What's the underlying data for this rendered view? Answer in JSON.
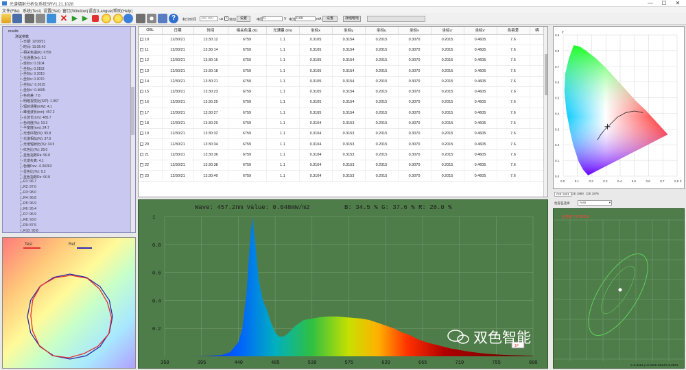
{
  "window": {
    "title": "光谱辐射分析仪系统SRV1.21.1028",
    "minimize": "—",
    "maximize": "☐",
    "close": "✕"
  },
  "menu": [
    "文件(File)",
    "系统(Test)",
    "设置(Set)",
    "窗口(Window)",
    "语言(Langue)",
    "帮助(Help)"
  ],
  "toolbar": {
    "icons": [
      "open-icon",
      "save-icon",
      "copy-icon",
      "paste-icon",
      "export-icon",
      "delete-icon",
      "run-icon",
      "run-all-icon",
      "stop-icon",
      "lamp-icon",
      "lamp2-icon",
      "refresh-icon",
      "calculator-icon",
      "settings-icon",
      "chart-icon",
      "help-icon"
    ],
    "integration_label": "积分时间",
    "integration_value": "300 000",
    "integration_unit": "us",
    "auto_label": "自动",
    "set_button": "设置",
    "voltage_label": "电压",
    "voltage_value": "0",
    "voltage_unit": "V",
    "current_label": "电流",
    "current_value": "0.00",
    "current_unit": "mA",
    "set_button2": "设置",
    "dark_button": "存储暗电"
  },
  "tree": {
    "root": "results",
    "node": "测试参数",
    "items": [
      "日期: 12/30/21",
      "时间: 13:35:40",
      "相关色温(K): 6759",
      "光通量(lm): 1.1",
      "坐标x: 0.3104",
      "坐标y: 0.3153",
      "坐标u: 0.2015",
      "坐标v: 0.3070",
      "坐标u': 0.2015",
      "坐标v': 0.4605",
      "色容差: 7.6",
      "明暗视觉比(S/P): 1.067",
      "辐射通量(mW): 4.1",
      "峰值波长(nm): 457.2",
      "主波长(nm): 485.7",
      "色纯度(%): 19.3",
      "半宽度(nm): 24.7",
      "光谱匹配(%): 95.8",
      "光谱相似(%): 37.6",
      "光谱辐射比(%): 34.5",
      "红色比(%): 28.0",
      "显色指数Ra: 96.8",
      "光谱失真: 4.1",
      "色偏Duv: -0.00263",
      "显色比(%): 9.2",
      "显色指数Re: 90.8",
      "R1: 96.7",
      "R2: 97.6",
      "R3: 98.0",
      "R4: 96.8",
      "R5: 96.9",
      "R6: 95.4",
      "R7: 96.9",
      "R8: 93.0",
      "R9: 87.5",
      "R10: 90.8"
    ]
  },
  "color_chart": {
    "legend_test": "Test",
    "legend_ref": "Ref",
    "test_color": "#e03030",
    "ref_color": "#2a2ab0"
  },
  "table": {
    "headers": [
      "OBL",
      "日期",
      "时间",
      "相关色温 (K)",
      "光通量 (lm)",
      "坐标x",
      "坐标y",
      "坐标u",
      "坐标v",
      "坐标u'",
      "坐标v'",
      "色容差",
      "明"
    ],
    "rows": [
      [
        "10",
        "12/30/21",
        "13:30:12",
        "6759",
        "1.1",
        "0.3105",
        "0.3154",
        "0.2015",
        "0.3070",
        "0.2015",
        "0.4605",
        "7.6"
      ],
      [
        "11",
        "12/30/21",
        "13:30:14",
        "6759",
        "1.1",
        "0.3105",
        "0.3154",
        "0.2015",
        "0.3070",
        "0.2015",
        "0.4605",
        "7.6"
      ],
      [
        "12",
        "12/30/21",
        "13:30:16",
        "6759",
        "1.1",
        "0.3105",
        "0.3154",
        "0.2015",
        "0.3070",
        "0.2015",
        "0.4605",
        "7.6"
      ],
      [
        "13",
        "12/30/21",
        "13:30:18",
        "6759",
        "1.1",
        "0.3105",
        "0.3154",
        "0.2015",
        "0.3070",
        "0.2015",
        "0.4605",
        "7.6"
      ],
      [
        "14",
        "12/30/21",
        "13:30:21",
        "6759",
        "1.1",
        "0.3105",
        "0.3154",
        "0.2015",
        "0.3070",
        "0.2015",
        "0.4605",
        "7.6"
      ],
      [
        "15",
        "12/30/21",
        "13:30:23",
        "6759",
        "1.1",
        "0.3105",
        "0.3154",
        "0.2015",
        "0.3070",
        "0.2015",
        "0.4605",
        "7.6"
      ],
      [
        "16",
        "12/30/21",
        "13:30:25",
        "6759",
        "1.1",
        "0.3105",
        "0.3154",
        "0.2015",
        "0.3070",
        "0.2015",
        "0.4605",
        "7.6"
      ],
      [
        "17",
        "12/30/21",
        "13:30:27",
        "6759",
        "1.1",
        "0.3105",
        "0.3154",
        "0.2015",
        "0.3070",
        "0.2015",
        "0.4605",
        "7.6"
      ],
      [
        "18",
        "12/30/21",
        "13:30:29",
        "6759",
        "1.1",
        "0.3104",
        "0.3153",
        "0.2015",
        "0.3070",
        "0.2015",
        "0.4605",
        "7.6"
      ],
      [
        "19",
        "12/30/21",
        "13:30:32",
        "6759",
        "1.1",
        "0.3104",
        "0.3153",
        "0.2015",
        "0.3070",
        "0.2015",
        "0.4605",
        "7.6"
      ],
      [
        "20",
        "12/30/21",
        "13:30:34",
        "6759",
        "1.1",
        "0.3104",
        "0.3153",
        "0.2015",
        "0.3070",
        "0.2015",
        "0.4605",
        "7.6"
      ],
      [
        "21",
        "12/30/21",
        "13:30:36",
        "6759",
        "1.1",
        "0.3104",
        "0.3153",
        "0.2015",
        "0.3070",
        "0.2015",
        "0.4605",
        "7.6"
      ],
      [
        "22",
        "12/30/21",
        "13:30:38",
        "6759",
        "1.1",
        "0.3104",
        "0.3153",
        "0.2015",
        "0.3070",
        "0.2015",
        "0.4605",
        "7.6"
      ],
      [
        "23",
        "12/30/21",
        "13:30:40",
        "6759",
        "1.1",
        "0.3104",
        "0.3153",
        "0.2015",
        "0.3070",
        "0.2015",
        "0.4605",
        "7.6"
      ]
    ]
  },
  "spectrum": {
    "header": "Wave: 457.2nm Value: 0.048mW/m2",
    "ratios": "B: 34.5 %  G: 37.6 %  R: 28.0 %",
    "marker": "1P",
    "watermark": "双色智能"
  },
  "cie": {
    "tabs": [
      "CIE 1931",
      "CIE 1960",
      "CIE 1976"
    ],
    "x_ticks": [
      "0.0",
      "0.1",
      "0.2",
      "0.3",
      "0.4",
      "0.5",
      "0.6",
      "0.7",
      "0.8"
    ],
    "y_ticks": [
      "0.9",
      "0.8",
      "0.7",
      "0.6",
      "0.5",
      "0.4",
      "0.3",
      "0.2",
      "0.1",
      "0.0"
    ],
    "x_axis_label": "x",
    "y_axis_label": "y"
  },
  "cct": {
    "label": "色容差选择",
    "value": "Auto",
    "readout": "x=0.3113 y=0.3156 SDCM=6.9694",
    "title_red": "色容差 7.6 SDCM"
  },
  "chart_data": {
    "type": "area",
    "title": "Wave: 457.2nm Value: 0.048mW/m2",
    "xlabel": "",
    "ylabel": "",
    "xlim": [
      350,
      800
    ],
    "ylim": [
      0,
      1.0
    ],
    "x_ticks": [
      350,
      395,
      440,
      485,
      530,
      575,
      620,
      665,
      710,
      755,
      800
    ],
    "y_ticks": [
      0.2,
      0.4,
      0.6,
      0.8,
      1.0
    ],
    "x": [
      350,
      380,
      400,
      420,
      430,
      440,
      445,
      450,
      454,
      457,
      460,
      465,
      470,
      475,
      480,
      485,
      490,
      495,
      500,
      510,
      520,
      530,
      540,
      550,
      560,
      570,
      580,
      590,
      600,
      610,
      620,
      630,
      640,
      650,
      660,
      670,
      680,
      690,
      700,
      710,
      720,
      730,
      740,
      750,
      760,
      770,
      780,
      790,
      800
    ],
    "values": [
      0,
      0,
      0.002,
      0.01,
      0.03,
      0.1,
      0.2,
      0.45,
      0.8,
      1.0,
      0.85,
      0.55,
      0.4,
      0.33,
      0.24,
      0.17,
      0.14,
      0.14,
      0.16,
      0.22,
      0.26,
      0.27,
      0.28,
      0.285,
      0.285,
      0.28,
      0.275,
      0.27,
      0.26,
      0.24,
      0.22,
      0.2,
      0.17,
      0.15,
      0.12,
      0.1,
      0.085,
      0.07,
      0.055,
      0.045,
      0.035,
      0.027,
      0.02,
      0.015,
      0.012,
      0.009,
      0.007,
      0.005,
      0.003
    ]
  }
}
